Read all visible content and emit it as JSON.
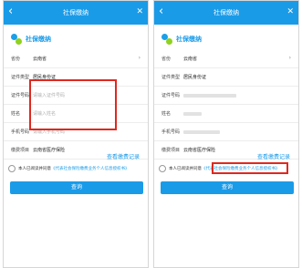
{
  "app": {
    "title": "社保缴纳",
    "back_glyph": "‹",
    "close_glyph": "✕"
  },
  "brand": {
    "name": "社保缴纳"
  },
  "form": {
    "province": {
      "label": "省份",
      "value": "云南省",
      "caret": "›"
    },
    "id_type": {
      "label": "证件类型",
      "value": "居民身份证"
    },
    "id_number": {
      "label": "证件号码",
      "placeholder": "请输入证件号码"
    },
    "name": {
      "label": "姓名",
      "placeholder": "请输入姓名"
    },
    "phone": {
      "label": "手机号码",
      "placeholder": "请输入手机号码"
    },
    "payment_channel": {
      "label": "缴费项目",
      "value": "云南省医疗保险"
    }
  },
  "links": {
    "payment_records": "查看缴费记录"
  },
  "agreement": {
    "prefix": "本人已阅读并同意",
    "doc": "《代表社会保险缴费业务个人信息授权书》"
  },
  "buttons": {
    "query": "查询"
  },
  "colors": {
    "brand_blue": "#1a9be8",
    "highlight_red": "#e0281f",
    "logo_green": "#8fd21f"
  },
  "icons": {
    "back": "chevron-left-icon",
    "close": "close-icon",
    "logo": "social-security-logo-icon",
    "radio": "radio-unchecked-icon"
  }
}
